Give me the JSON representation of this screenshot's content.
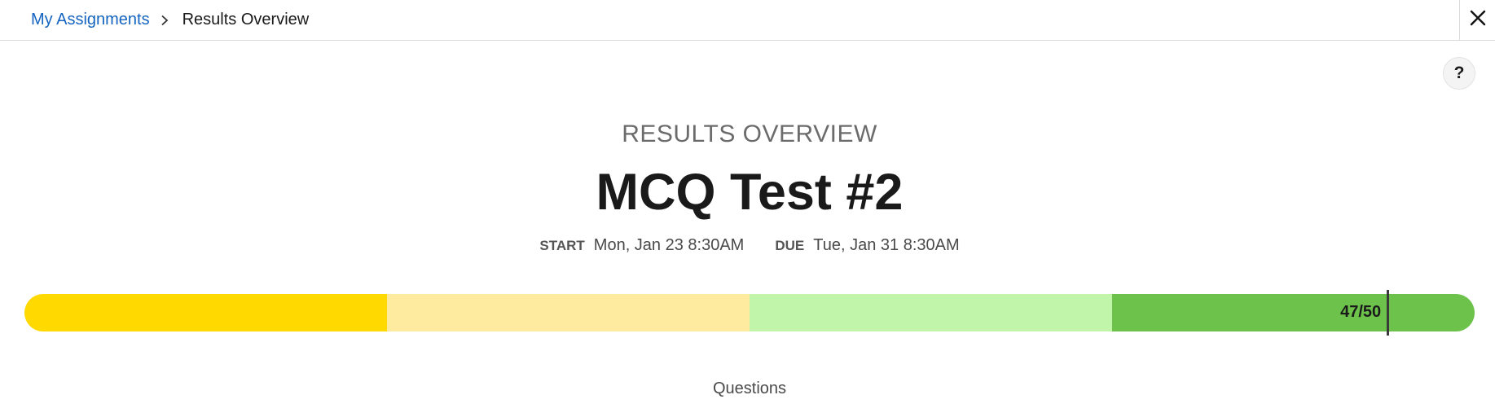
{
  "breadcrumb": {
    "parent_label": "My Assignments",
    "current_label": "Results Overview"
  },
  "icons": {
    "separator": "chevron-right-icon",
    "close": "close-icon",
    "help": "help-icon"
  },
  "help_button": {
    "label": "?"
  },
  "header": {
    "section_label": "RESULTS OVERVIEW",
    "title": "MCQ Test #2"
  },
  "dates": {
    "start_key": "START",
    "start_value": "Mon, Jan 23 8:30AM",
    "due_key": "DUE",
    "due_value": "Tue, Jan 31 8:30AM"
  },
  "score": {
    "label": "47/50",
    "earned": 47,
    "total": 50,
    "bands": [
      {
        "color": "#ffd900"
      },
      {
        "color": "#ffeba0"
      },
      {
        "color": "#c0f5aa"
      },
      {
        "color": "#6cc24a"
      }
    ]
  },
  "questions": {
    "label": "Questions"
  }
}
